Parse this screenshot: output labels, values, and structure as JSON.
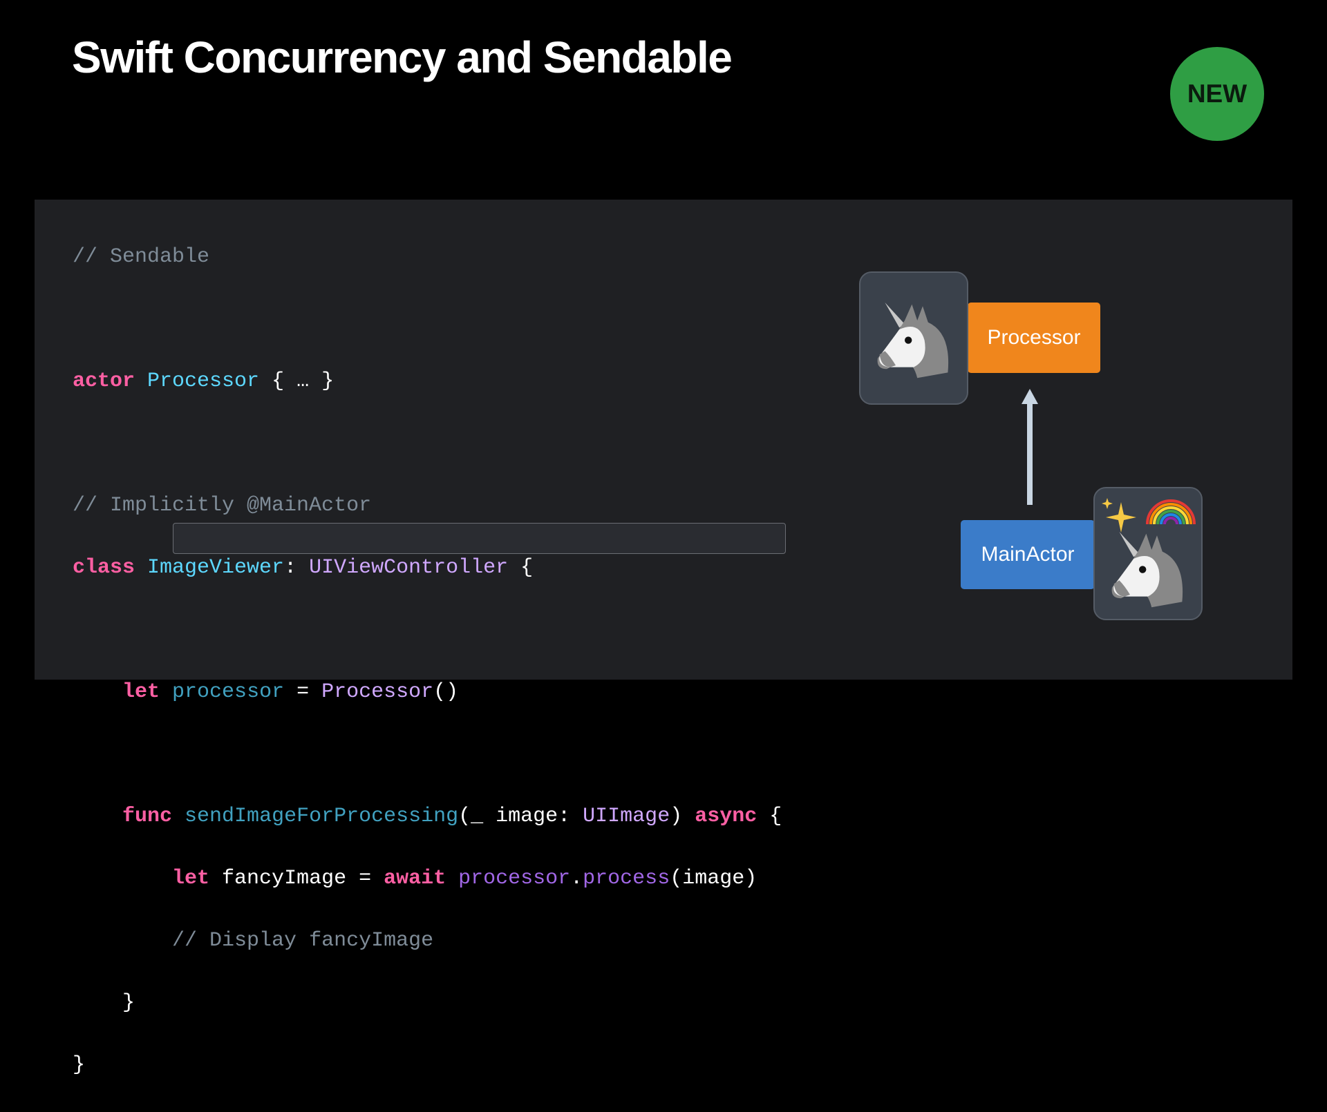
{
  "slide": {
    "title": "Swift Concurrency and Sendable",
    "badge": "NEW"
  },
  "code": {
    "l0": "// Sendable",
    "l2": {
      "kw": "actor",
      "type": "Processor",
      "rest": " { … }"
    },
    "l4": "// Implicitly @MainActor",
    "l5": {
      "kw": "class",
      "type": "ImageViewer",
      "colon": ": ",
      "super": "UIViewController",
      "rest": " {"
    },
    "l7": {
      "kw": "let",
      "name": "processor",
      "eq": " = ",
      "init": "Processor",
      "rest": "()"
    },
    "l9": {
      "kw": "func",
      "name": "sendImageForProcessing",
      "p1": "(_",
      "p2": " image: ",
      "ptype": "UIImage",
      "p3": ") ",
      "kw2": "async",
      "rest": " {"
    },
    "l10": {
      "kw": "let",
      "name": " fancyImage = ",
      "kw2": "await",
      "obj": "processor",
      "dot": ".",
      "fn": "process",
      "rest": "(image)"
    },
    "l11": "// Display fancyImage",
    "l12": "}",
    "l13": "}"
  },
  "diagram": {
    "processor_label": "Processor",
    "mainactor_label": "MainActor",
    "colors": {
      "processor": "#f0861c",
      "mainactor": "#3b7cc9",
      "arrow": "#c9d6e3"
    }
  }
}
